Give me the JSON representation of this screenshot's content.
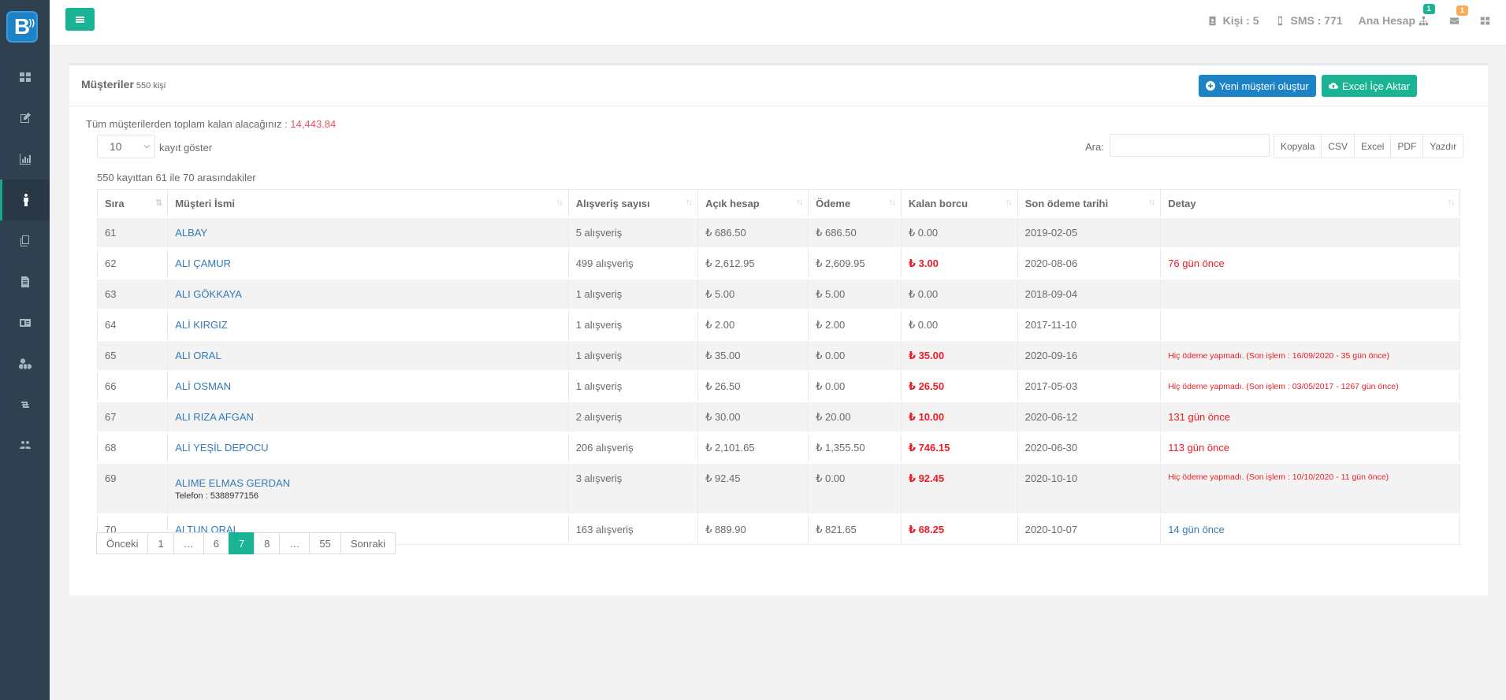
{
  "sidebar": {
    "logo": "B",
    "items": [
      {
        "icon": "dashboard-icon"
      },
      {
        "icon": "edit-icon"
      },
      {
        "icon": "bar-chart-icon"
      },
      {
        "icon": "male-icon",
        "active": true
      },
      {
        "icon": "files-icon"
      },
      {
        "icon": "file-text-icon"
      },
      {
        "icon": "id-card-icon"
      },
      {
        "icon": "cubes-icon"
      },
      {
        "icon": "retweet-icon"
      },
      {
        "icon": "users-icon"
      }
    ]
  },
  "topbar": {
    "kisi": "Kişi : 5",
    "sms": "SMS : 771",
    "account": "Ana Hesap",
    "account_badge": "1",
    "mail_badge": "1"
  },
  "panel": {
    "title": "Müşteriler",
    "subtitle": "550 kişi",
    "new_button": "Yeni müşteri oluştur",
    "import_button": "Excel İçe Aktar"
  },
  "summary": {
    "label": "Tüm müşterilerden toplam kalan alacağınız : ",
    "amount": "14,443.84"
  },
  "controls": {
    "page_length": "10",
    "page_length_label": "kayıt göster",
    "search_label": "Ara:",
    "search_value": "",
    "export_buttons": [
      "Kopyala",
      "CSV",
      "Excel",
      "PDF",
      "Yazdır"
    ],
    "info": "550 kayıttan 61 ile 70 arasındakiler"
  },
  "table": {
    "headers": [
      "Sıra",
      "Müşteri İsmi",
      "Alışveriş sayısı",
      "Açık hesap",
      "Ödeme",
      "Kalan borcu",
      "Son ödeme tarihi",
      "Detay"
    ],
    "rows": [
      {
        "no": "61",
        "name": "ALBAY",
        "phone": "",
        "count": "5 alışveriş",
        "open": "₺ 686.50",
        "paid": "₺ 686.50",
        "rem": "₺ 0.00",
        "rem_red": false,
        "date": "2019-02-05",
        "detail": "",
        "detail_style": ""
      },
      {
        "no": "62",
        "name": "ALI ÇAMUR",
        "phone": "",
        "count": "499 alışveriş",
        "open": "₺ 2,612.95",
        "paid": "₺ 2,609.95",
        "rem": "₺ 3.00",
        "rem_red": true,
        "date": "2020-08-06",
        "detail": "76 gün önce",
        "detail_style": "red"
      },
      {
        "no": "63",
        "name": "ALI GÖKKAYA",
        "phone": "",
        "count": "1 alışveriş",
        "open": "₺ 5.00",
        "paid": "₺ 5.00",
        "rem": "₺ 0.00",
        "rem_red": false,
        "date": "2018-09-04",
        "detail": "",
        "detail_style": ""
      },
      {
        "no": "64",
        "name": "ALİ KIRGIZ",
        "phone": "",
        "count": "1 alışveriş",
        "open": "₺ 2.00",
        "paid": "₺ 2.00",
        "rem": "₺ 0.00",
        "rem_red": false,
        "date": "2017-11-10",
        "detail": "",
        "detail_style": ""
      },
      {
        "no": "65",
        "name": "ALI ORAL",
        "phone": "",
        "count": "1 alışveriş",
        "open": "₺ 35.00",
        "paid": "₺ 0.00",
        "rem": "₺ 35.00",
        "rem_red": true,
        "date": "2020-09-16",
        "detail": "Hiç ödeme yapmadı. (Son işlem : 16/09/2020 - 35 gün önce)",
        "detail_style": "small"
      },
      {
        "no": "66",
        "name": "ALİ OSMAN",
        "phone": "",
        "count": "1 alışveriş",
        "open": "₺ 26.50",
        "paid": "₺ 0.00",
        "rem": "₺ 26.50",
        "rem_red": true,
        "date": "2017-05-03",
        "detail": "Hiç ödeme yapmadı. (Son işlem : 03/05/2017 - 1267 gün önce)",
        "detail_style": "small"
      },
      {
        "no": "67",
        "name": "ALI RIZA AFGAN",
        "phone": "",
        "count": "2 alışveriş",
        "open": "₺ 30.00",
        "paid": "₺ 20.00",
        "rem": "₺ 10.00",
        "rem_red": true,
        "date": "2020-06-12",
        "detail": "131 gün önce",
        "detail_style": "red"
      },
      {
        "no": "68",
        "name": "ALİ YEŞİL DEPOCU",
        "phone": "",
        "count": "206 alışveriş",
        "open": "₺ 2,101.65",
        "paid": "₺ 1,355.50",
        "rem": "₺ 746.15",
        "rem_red": true,
        "date": "2020-06-30",
        "detail": "113 gün önce",
        "detail_style": "red"
      },
      {
        "no": "69",
        "name": "ALIME ELMAS GERDAN",
        "phone": "Telefon : 5388977156",
        "count": "3 alışveriş",
        "open": "₺ 92.45",
        "paid": "₺ 0.00",
        "rem": "₺ 92.45",
        "rem_red": true,
        "date": "2020-10-10",
        "detail": "Hiç ödeme yapmadı. (Son işlem : 10/10/2020 - 11 gün önce)",
        "detail_style": "small"
      },
      {
        "no": "70",
        "name": "ALTUN ORAL",
        "phone": "",
        "count": "163 alışveriş",
        "open": "₺ 889.90",
        "paid": "₺ 821.65",
        "rem": "₺ 68.25",
        "rem_red": true,
        "date": "2020-10-07",
        "detail": "14 gün önce",
        "detail_style": "blue"
      }
    ]
  },
  "pagination": {
    "prev": "Önceki",
    "pages": [
      "1",
      "…",
      "6",
      "7",
      "8",
      "…",
      "55"
    ],
    "active": "7",
    "next": "Sonraki"
  },
  "colors": {
    "sidebar": "#2f4050",
    "primary": "#1ab394",
    "blue": "#1c84c6",
    "danger": "#ed1c24"
  }
}
